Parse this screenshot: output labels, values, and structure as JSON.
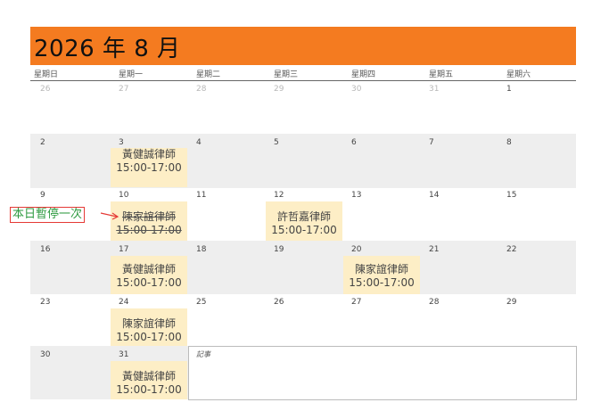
{
  "title": "2026 年 8 月",
  "weekdays": [
    "星期日",
    "星期一",
    "星期二",
    "星期三",
    "星期四",
    "星期五",
    "星期六"
  ],
  "weeks": [
    [
      "26",
      "27",
      "28",
      "29",
      "30",
      "31",
      "1"
    ],
    [
      "2",
      "3",
      "4",
      "5",
      "6",
      "7",
      "8"
    ],
    [
      "9",
      "10",
      "11",
      "12",
      "13",
      "14",
      "15"
    ],
    [
      "16",
      "17",
      "18",
      "19",
      "20",
      "21",
      "22"
    ],
    [
      "23",
      "24",
      "25",
      "26",
      "27",
      "28",
      "29"
    ],
    [
      "30",
      "31"
    ]
  ],
  "events": [
    {
      "name": "黃健誠律師",
      "time": "15:00-17:00",
      "cancelled": false
    },
    {
      "name": "陳家誼律師",
      "time": "15:00-17:00",
      "cancelled": true
    },
    {
      "name": "許哲嘉律師",
      "time": "15:00-17:00",
      "cancelled": false
    },
    {
      "name": "黃健誠律師",
      "time": "15:00-17:00",
      "cancelled": false
    },
    {
      "name": "陳家誼律師",
      "time": "15:00-17:00",
      "cancelled": false
    },
    {
      "name": "陳家誼律師",
      "time": "15:00-17:00",
      "cancelled": false
    },
    {
      "name": "黃健誠律師",
      "time": "15:00-17:00",
      "cancelled": false
    }
  ],
  "notes_label": "記事",
  "pause_annotation": "本日暫停一次",
  "colors": {
    "banner": "#f47b20",
    "event_bg": "#fdeec6",
    "shaded_row": "#eeeeee",
    "annotation_border": "#e53935",
    "annotation_text": "#2e9a40"
  }
}
